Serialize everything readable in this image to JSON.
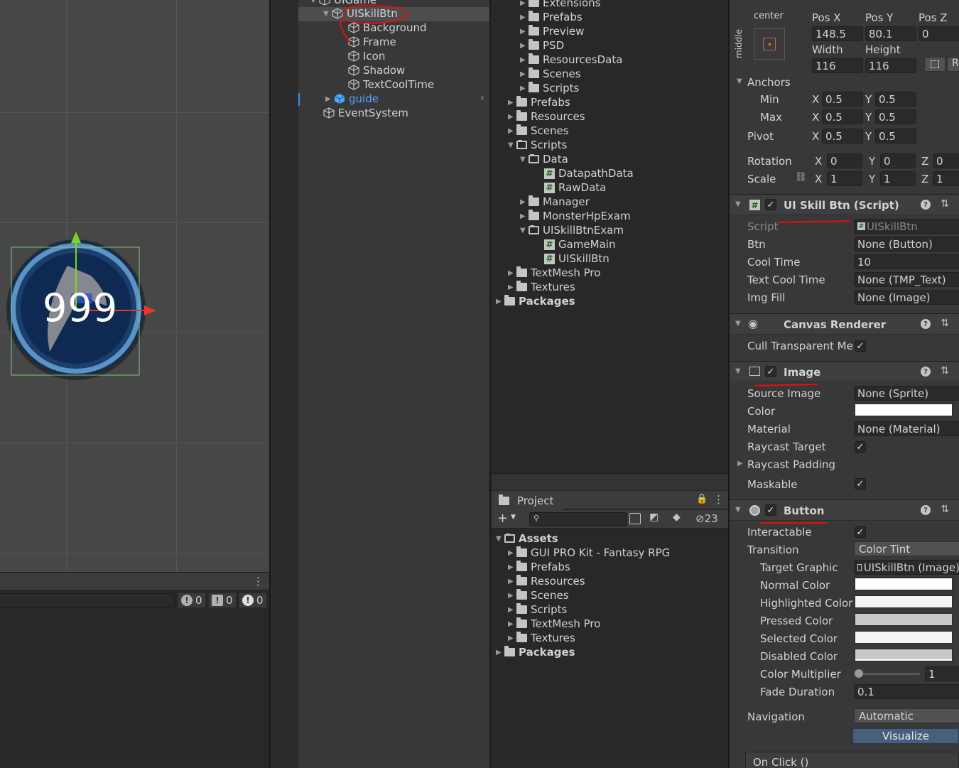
{
  "scene": {
    "sprite_text": "999"
  },
  "console": {
    "info_count": "0",
    "warning_count": "0",
    "error_count": "0"
  },
  "hierarchy": {
    "items": [
      {
        "label": "UIGame"
      },
      {
        "label": "UISkillBtn"
      },
      {
        "label": "Background"
      },
      {
        "label": "Frame"
      },
      {
        "label": "Icon"
      },
      {
        "label": "Shadow"
      },
      {
        "label": "TextCoolTime"
      },
      {
        "label": "guide"
      },
      {
        "label": "EventSystem"
      }
    ]
  },
  "project_tree": {
    "items": [
      {
        "label": "Extensions"
      },
      {
        "label": "Prefabs"
      },
      {
        "label": "Preview"
      },
      {
        "label": "PSD"
      },
      {
        "label": "ResourcesData"
      },
      {
        "label": "Scenes"
      },
      {
        "label": "Scripts"
      },
      {
        "label": "Prefabs"
      },
      {
        "label": "Resources"
      },
      {
        "label": "Scenes"
      },
      {
        "label": "Scripts"
      },
      {
        "label": "Data"
      },
      {
        "label": "DatapathData"
      },
      {
        "label": "RawData"
      },
      {
        "label": "Manager"
      },
      {
        "label": "MonsterHpExam"
      },
      {
        "label": "UISkillBtnExam"
      },
      {
        "label": "GameMain"
      },
      {
        "label": "UISkillBtn"
      },
      {
        "label": "TextMesh Pro"
      },
      {
        "label": "Textures"
      },
      {
        "label": "Packages"
      }
    ]
  },
  "project_panel": {
    "tab_label": "Project",
    "hidden_count": "23",
    "items": [
      {
        "label": "Assets"
      },
      {
        "label": "GUI PRO Kit - Fantasy RPG"
      },
      {
        "label": "Prefabs"
      },
      {
        "label": "Resources"
      },
      {
        "label": "Scenes"
      },
      {
        "label": "Scripts"
      },
      {
        "label": "TextMesh Pro"
      },
      {
        "label": "Textures"
      },
      {
        "label": "Packages"
      }
    ]
  },
  "inspector": {
    "rect": {
      "anchor_preset": "center",
      "anchor_side": "middle",
      "pos_x_label": "Pos X",
      "pos_x": "148.5",
      "pos_y_label": "Pos Y",
      "pos_y": "80.1",
      "pos_z_label": "Pos Z",
      "pos_z": "0",
      "width_label": "Width",
      "width": "116",
      "height_label": "Height",
      "height": "116",
      "r_label": "R"
    },
    "anchors": {
      "label": "Anchors",
      "min_label": "Min",
      "min_x": "0.5",
      "min_y": "0.5",
      "max_label": "Max",
      "max_x": "0.5",
      "max_y": "0.5"
    },
    "pivot": {
      "label": "Pivot",
      "x": "0.5",
      "y": "0.5"
    },
    "rotation": {
      "label": "Rotation",
      "x": "0",
      "y": "0",
      "z": "0"
    },
    "scale": {
      "label": "Scale",
      "x": "1",
      "y": "1",
      "z": "1"
    },
    "axis": {
      "x": "X",
      "y": "Y",
      "z": "Z"
    },
    "script_comp": {
      "title": "UI Skill Btn (Script)",
      "script_label": "Script",
      "script_value": "UISkillBtn",
      "btn_label": "Btn",
      "btn_value": "None (Button)",
      "cooltime_label": "Cool Time",
      "cooltime_value": "10",
      "textcool_label": "Text Cool Time",
      "textcool_value": "None (TMP_Text)",
      "imgfill_label": "Img Fill",
      "imgfill_value": "None (Image)"
    },
    "canvas_renderer": {
      "title": "Canvas Renderer",
      "cull_label": "Cull Transparent Me"
    },
    "image_comp": {
      "title": "Image",
      "source_label": "Source Image",
      "source_value": "None (Sprite)",
      "color_label": "Color",
      "material_label": "Material",
      "material_value": "None (Material)",
      "raycast_label": "Raycast Target",
      "padding_label": "Raycast Padding",
      "maskable_label": "Maskable"
    },
    "button_comp": {
      "title": "Button",
      "interactable_label": "Interactable",
      "transition_label": "Transition",
      "transition_value": "Color Tint",
      "target_label": "Target Graphic",
      "target_value": "UISkillBtn (Image)",
      "normal_label": "Normal Color",
      "highlighted_label": "Highlighted Color",
      "pressed_label": "Pressed Color",
      "selected_label": "Selected Color",
      "disabled_label": "Disabled Color",
      "multiplier_label": "Color Multiplier",
      "multiplier_value": "1",
      "fade_label": "Fade Duration",
      "fade_value": "0.1",
      "navigation_label": "Navigation",
      "navigation_value": "Automatic",
      "visualize_label": "Visualize",
      "onclick_label": "On Click ()"
    }
  }
}
